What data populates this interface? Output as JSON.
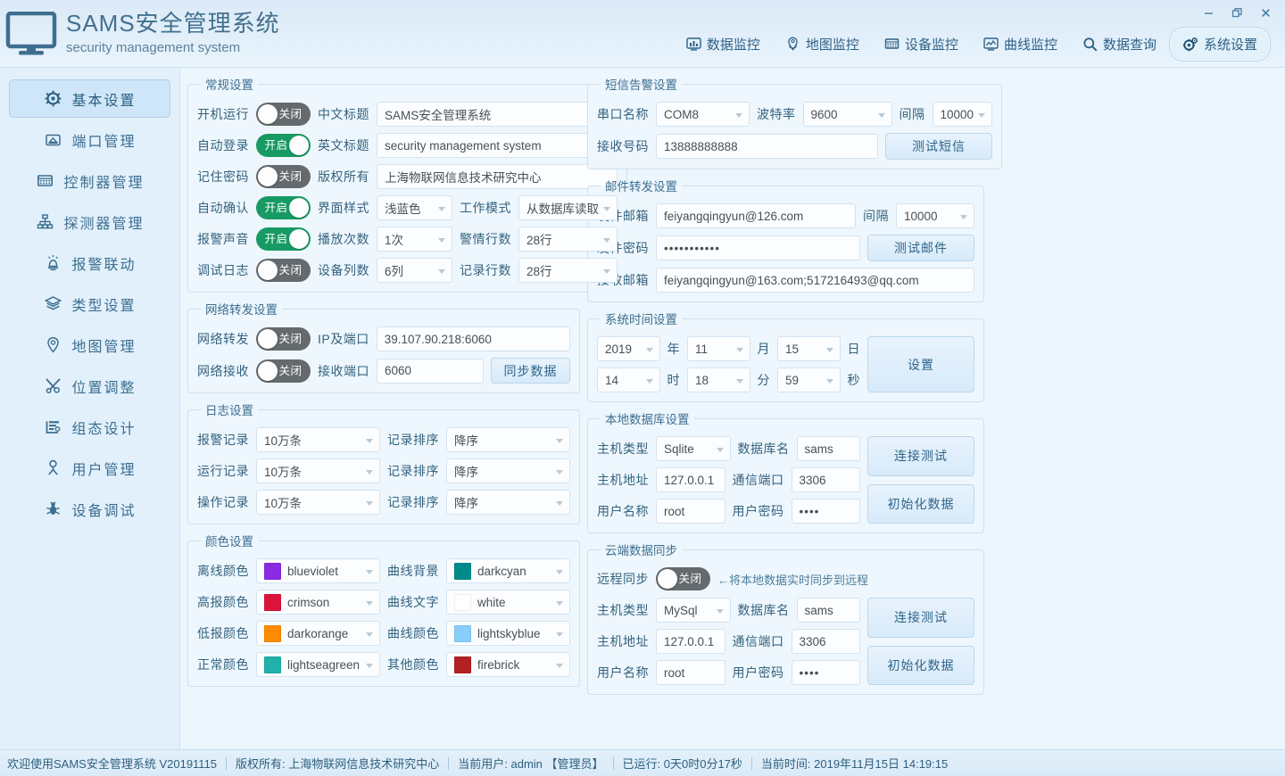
{
  "window": {
    "minimize": "–",
    "maximize": "❐",
    "close": "✕"
  },
  "header": {
    "title_cn": "SAMS安全管理系统",
    "title_en": "security management system",
    "nav": [
      {
        "label": "数据监控",
        "icon": "data-monitor-icon",
        "active": false
      },
      {
        "label": "地图监控",
        "icon": "map-monitor-icon",
        "active": false
      },
      {
        "label": "设备监控",
        "icon": "device-monitor-icon",
        "active": false
      },
      {
        "label": "曲线监控",
        "icon": "curve-monitor-icon",
        "active": false
      },
      {
        "label": "数据查询",
        "icon": "search-icon",
        "active": false
      },
      {
        "label": "系统设置",
        "icon": "gear-icon",
        "active": true
      }
    ]
  },
  "sidebar": {
    "items": [
      {
        "label": "基本设置",
        "icon": "gear-icon",
        "active": true
      },
      {
        "label": "端口管理",
        "icon": "port-icon",
        "active": false
      },
      {
        "label": "控制器管理",
        "icon": "controller-icon",
        "active": false
      },
      {
        "label": "探测器管理",
        "icon": "detector-icon",
        "active": false
      },
      {
        "label": "报警联动",
        "icon": "alarm-icon",
        "active": false
      },
      {
        "label": "类型设置",
        "icon": "layers-icon",
        "active": false
      },
      {
        "label": "地图管理",
        "icon": "map-pin-icon",
        "active": false
      },
      {
        "label": "位置调整",
        "icon": "tools-icon",
        "active": false
      },
      {
        "label": "组态设计",
        "icon": "design-icon",
        "active": false
      },
      {
        "label": "用户管理",
        "icon": "user-icon",
        "active": false
      },
      {
        "label": "设备调试",
        "icon": "bug-icon",
        "active": false
      }
    ]
  },
  "general": {
    "legend": "常规设置",
    "rows": [
      {
        "toggle_label": "开机运行",
        "toggle_state": "关闭",
        "toggle_on": false,
        "field_label": "中文标题",
        "field_value": "SAMS安全管理系统"
      },
      {
        "toggle_label": "自动登录",
        "toggle_state": "开启",
        "toggle_on": true,
        "field_label": "英文标题",
        "field_value": "security management system"
      },
      {
        "toggle_label": "记住密码",
        "toggle_state": "关闭",
        "toggle_on": false,
        "field_label": "版权所有",
        "field_value": "上海物联网信息技术研究中心"
      }
    ],
    "row4": {
      "toggle_label": "自动确认",
      "toggle_state": "开启",
      "toggle_on": true,
      "label_a": "界面样式",
      "value_a": "浅蓝色",
      "label_b": "工作模式",
      "value_b": "从数据库读取"
    },
    "row5": {
      "toggle_label": "报警声音",
      "toggle_state": "开启",
      "toggle_on": true,
      "label_a": "播放次数",
      "value_a": "1次",
      "label_b": "警情行数",
      "value_b": "28行"
    },
    "row6": {
      "toggle_label": "调试日志",
      "toggle_state": "关闭",
      "toggle_on": false,
      "label_a": "设备列数",
      "value_a": "6列",
      "label_b": "记录行数",
      "value_b": "28行"
    }
  },
  "network": {
    "legend": "网络转发设置",
    "row1": {
      "toggle_label": "网络转发",
      "toggle_state": "关闭",
      "toggle_on": false,
      "field_label": "IP及端口",
      "field_value": "39.107.90.218:6060"
    },
    "row2": {
      "toggle_label": "网络接收",
      "toggle_state": "关闭",
      "toggle_on": false,
      "field_label": "接收端口",
      "field_value": "6060",
      "button": "同步数据"
    }
  },
  "log": {
    "legend": "日志设置",
    "rows": [
      {
        "label_a": "报警记录",
        "value_a": "10万条",
        "label_b": "记录排序",
        "value_b": "降序"
      },
      {
        "label_a": "运行记录",
        "value_a": "10万条",
        "label_b": "记录排序",
        "value_b": "降序"
      },
      {
        "label_a": "操作记录",
        "value_a": "10万条",
        "label_b": "记录排序",
        "value_b": "降序"
      }
    ]
  },
  "colors": {
    "legend": "颜色设置",
    "rows": [
      {
        "label_a": "离线颜色",
        "value_a": "blueviolet",
        "hex_a": "#8a2be2",
        "label_b": "曲线背景",
        "value_b": "darkcyan",
        "hex_b": "#008b8b"
      },
      {
        "label_a": "高报颜色",
        "value_a": "crimson",
        "hex_a": "#dc143c",
        "label_b": "曲线文字",
        "value_b": "white",
        "hex_b": "#ffffff"
      },
      {
        "label_a": "低报颜色",
        "value_a": "darkorange",
        "hex_a": "#ff8c00",
        "label_b": "曲线颜色",
        "value_b": "lightskyblue",
        "hex_b": "#87cefa"
      },
      {
        "label_a": "正常颜色",
        "value_a": "lightseagreen",
        "hex_a": "#20b2aa",
        "label_b": "其他颜色",
        "value_b": "firebrick",
        "hex_b": "#b22222"
      }
    ]
  },
  "sms": {
    "legend": "短信告警设置",
    "port_label": "串口名称",
    "port_value": "COM8",
    "baud_label": "波特率",
    "baud_value": "9600",
    "interval_label": "间隔",
    "interval_value": "10000",
    "number_label": "接收号码",
    "number_value": "13888888888",
    "test_button": "测试短信"
  },
  "mail": {
    "legend": "邮件转发设置",
    "sender_label": "发件邮箱",
    "sender_value": "feiyangqingyun@126.com",
    "interval_label": "间隔",
    "interval_value": "10000",
    "password_label": "发件密码",
    "password_value": "•••••••••••",
    "test_button": "测试邮件",
    "receiver_label": "接收邮箱",
    "receiver_value": "feiyangqingyun@163.com;517216493@qq.com"
  },
  "systime": {
    "legend": "系统时间设置",
    "year": "2019",
    "year_unit": "年",
    "month": "11",
    "month_unit": "月",
    "day": "15",
    "day_unit": "日",
    "hour": "14",
    "hour_unit": "时",
    "minute": "18",
    "minute_unit": "分",
    "second": "59",
    "second_unit": "秒",
    "button": "设置"
  },
  "localdb": {
    "legend": "本地数据库设置",
    "type_label": "主机类型",
    "type_value": "Sqlite",
    "dbname_label": "数据库名",
    "dbname_value": "sams",
    "addr_label": "主机地址",
    "addr_value": "127.0.0.1",
    "port_label": "通信端口",
    "port_value": "3306",
    "user_label": "用户名称",
    "user_value": "root",
    "pwd_label": "用户密码",
    "pwd_value": "••••",
    "test_button": "连接测试",
    "init_button": "初始化数据"
  },
  "clouddb": {
    "legend": "云端数据同步",
    "sync_label": "远程同步",
    "sync_state": "关闭",
    "sync_on": false,
    "sync_hint": "←将本地数据实时同步到远程",
    "type_label": "主机类型",
    "type_value": "MySql",
    "dbname_label": "数据库名",
    "dbname_value": "sams",
    "addr_label": "主机地址",
    "addr_value": "127.0.0.1",
    "port_label": "通信端口",
    "port_value": "3306",
    "user_label": "用户名称",
    "user_value": "root",
    "pwd_label": "用户密码",
    "pwd_value": "••••",
    "test_button": "连接测试",
    "init_button": "初始化数据"
  },
  "status": {
    "welcome": "欢迎使用SAMS安全管理系统 V20191115",
    "copyright": "版权所有: 上海物联网信息技术研究中心",
    "user": "当前用户: admin 【管理员】",
    "uptime": "已运行: 0天0时0分17秒",
    "time": "当前时间: 2019年11月15日 14:19:15"
  },
  "theme": {
    "accent": "#2f6489",
    "toggle_on": "#179a64",
    "toggle_off": "#646a6e",
    "panel_bg": "#eef7fd",
    "sidebar_bg": "#e1f0fb"
  }
}
